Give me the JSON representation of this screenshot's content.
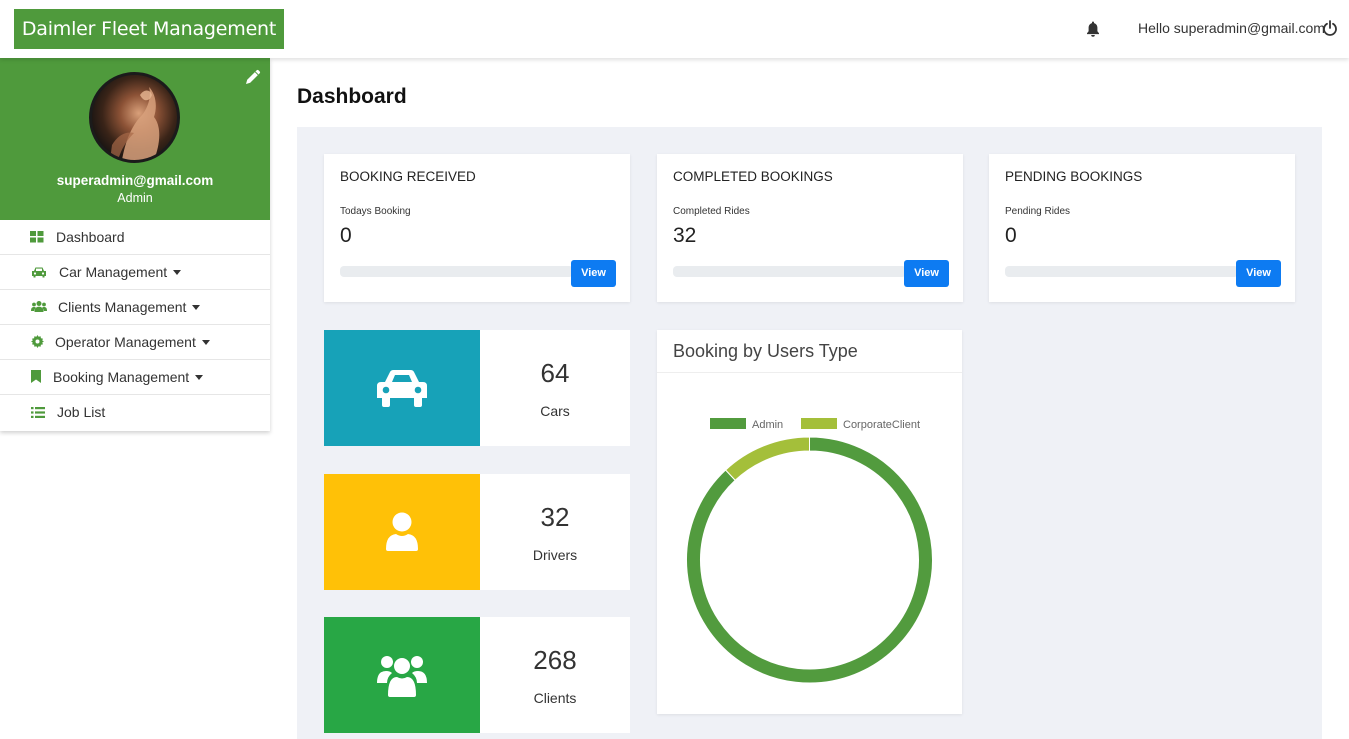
{
  "header": {
    "brand": "Daimler Fleet Management",
    "greeting": "Hello superadmin@gmail.com",
    "bell_icon": "bell-icon",
    "power_icon": "power-icon"
  },
  "sidebar": {
    "profile": {
      "email": "superadmin@gmail.com",
      "role": "Admin"
    },
    "items": [
      {
        "label": "Dashboard",
        "icon": "dashboard-icon"
      },
      {
        "label": "Car Management",
        "icon": "car-icon"
      },
      {
        "label": "Clients Management",
        "icon": "users-icon"
      },
      {
        "label": "Operator Management",
        "icon": "gear-icon"
      },
      {
        "label": "Booking Management",
        "icon": "bookmark-icon"
      },
      {
        "label": "Job List",
        "icon": "list-icon"
      }
    ]
  },
  "main": {
    "title": "Dashboard",
    "stat_cards": [
      {
        "title": "BOOKING RECEIVED",
        "sub": "Todays Booking",
        "value": "0",
        "button": "View"
      },
      {
        "title": "COMPLETED BOOKINGS",
        "sub": "Completed Rides",
        "value": "32",
        "button": "View"
      },
      {
        "title": "PENDING BOOKINGS",
        "sub": "Pending Rides",
        "value": "0",
        "button": "View"
      }
    ],
    "tiles": [
      {
        "value": "64",
        "label": "Cars",
        "color": "#17a2b8",
        "icon": "car-icon"
      },
      {
        "value": "32",
        "label": "Drivers",
        "color": "#ffc107",
        "icon": "user-icon"
      },
      {
        "value": "268",
        "label": "Clients",
        "color": "#28a745",
        "icon": "users-icon"
      }
    ]
  },
  "chart_data": {
    "type": "pie",
    "title": "Booking by Users Type",
    "legend_position": "top",
    "series": [
      {
        "name": "Admin",
        "value": 236,
        "color": "#529b3e"
      },
      {
        "name": "CorporateClient",
        "value": 32,
        "color": "#a4bf3a"
      }
    ]
  }
}
